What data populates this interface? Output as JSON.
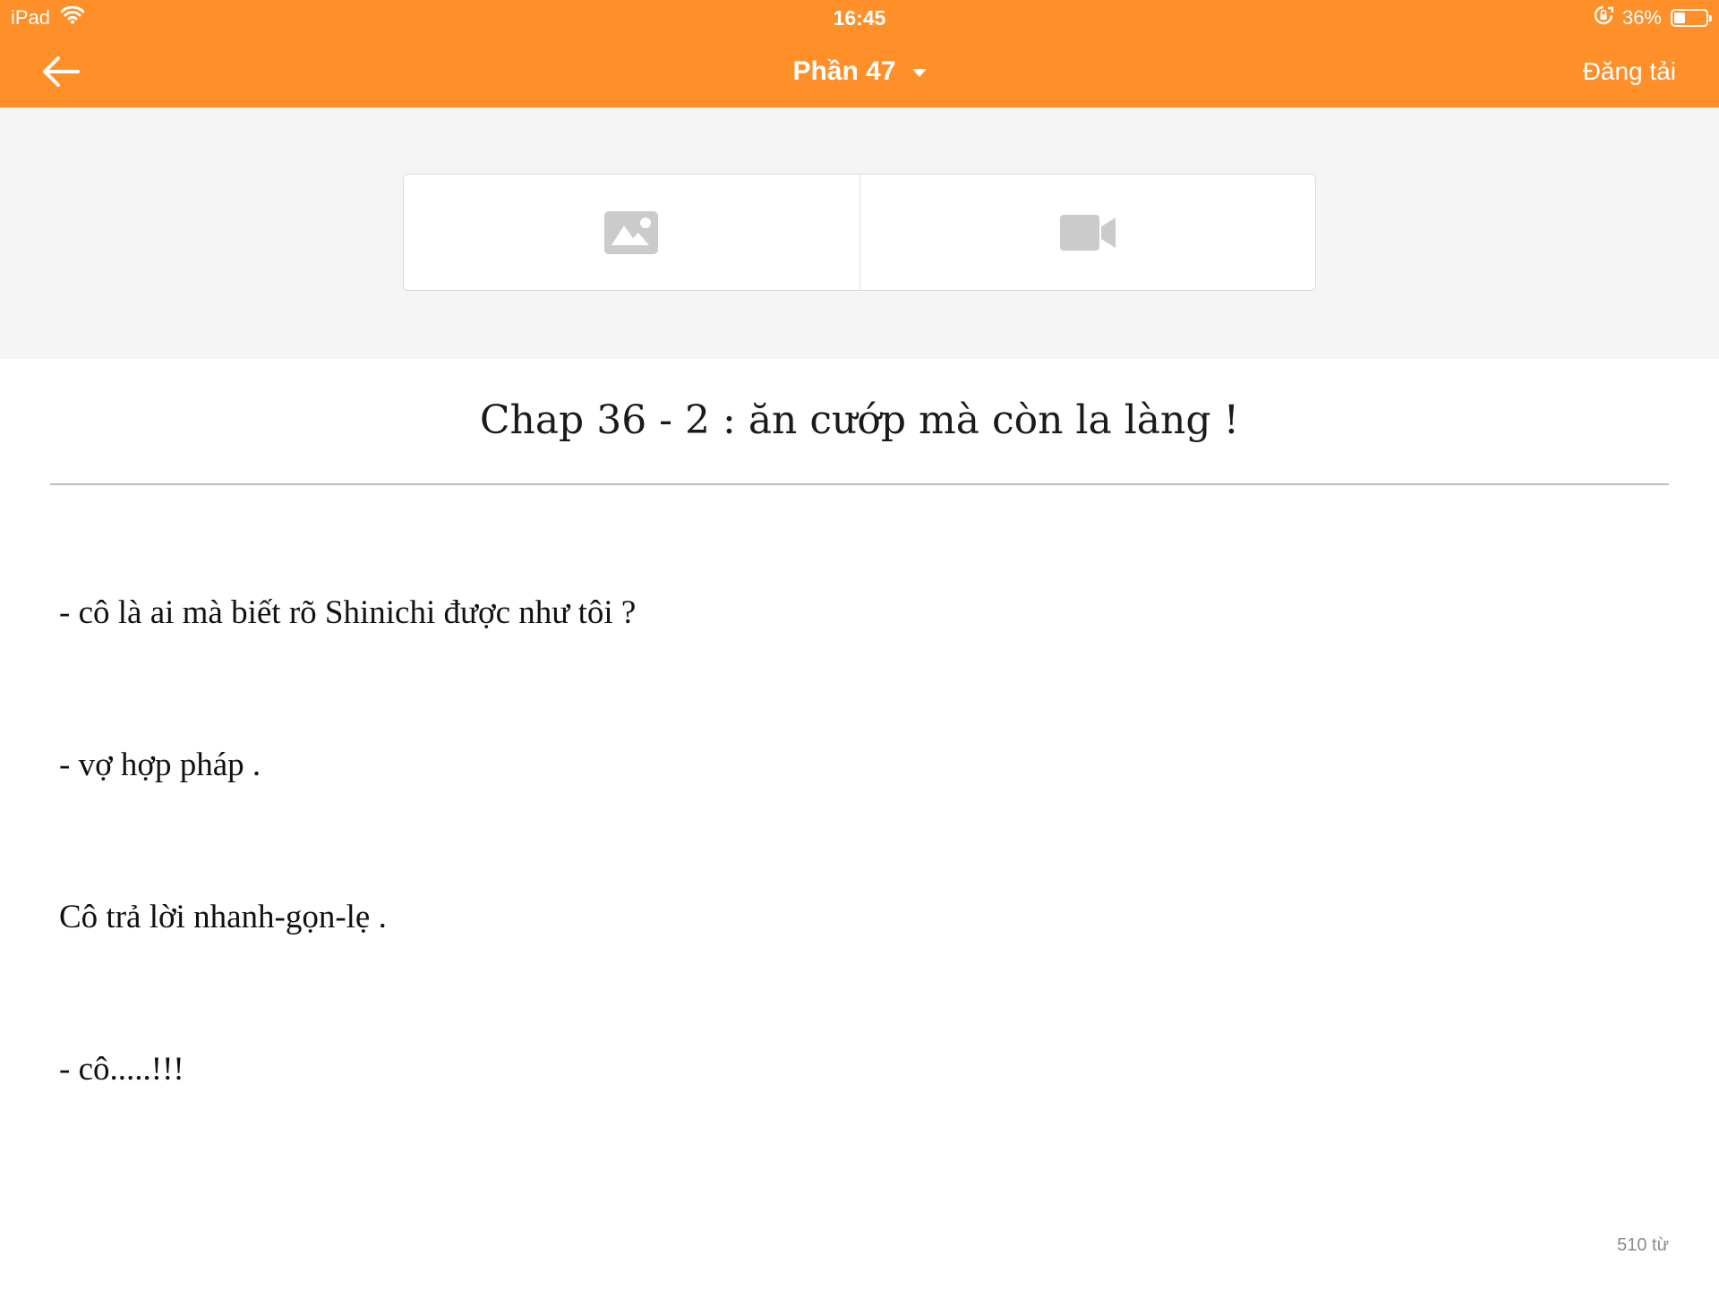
{
  "status_bar": {
    "device": "iPad",
    "time": "16:45",
    "battery_percent": "36%",
    "battery_level": 0.36
  },
  "header": {
    "title": "Phần 47",
    "publish_label": "Đăng tải"
  },
  "media": {
    "items": [
      {
        "icon": "image-icon"
      },
      {
        "icon": "video-icon"
      }
    ]
  },
  "chapter": {
    "title": "Chap 36 - 2 : ăn cướp mà còn la làng !",
    "paragraphs": [
      "- cô là ai mà biết rõ Shinichi được như tôi ?",
      "- vợ hợp pháp .",
      "Cô trả lời nhanh-gọn-lẹ .",
      "- cô.....!!!"
    ]
  },
  "footer": {
    "word_count": "510 từ"
  },
  "colors": {
    "accent": "#ff9029",
    "media_bg": "#f5f5f5",
    "icon_gray": "#cbcbcb"
  }
}
